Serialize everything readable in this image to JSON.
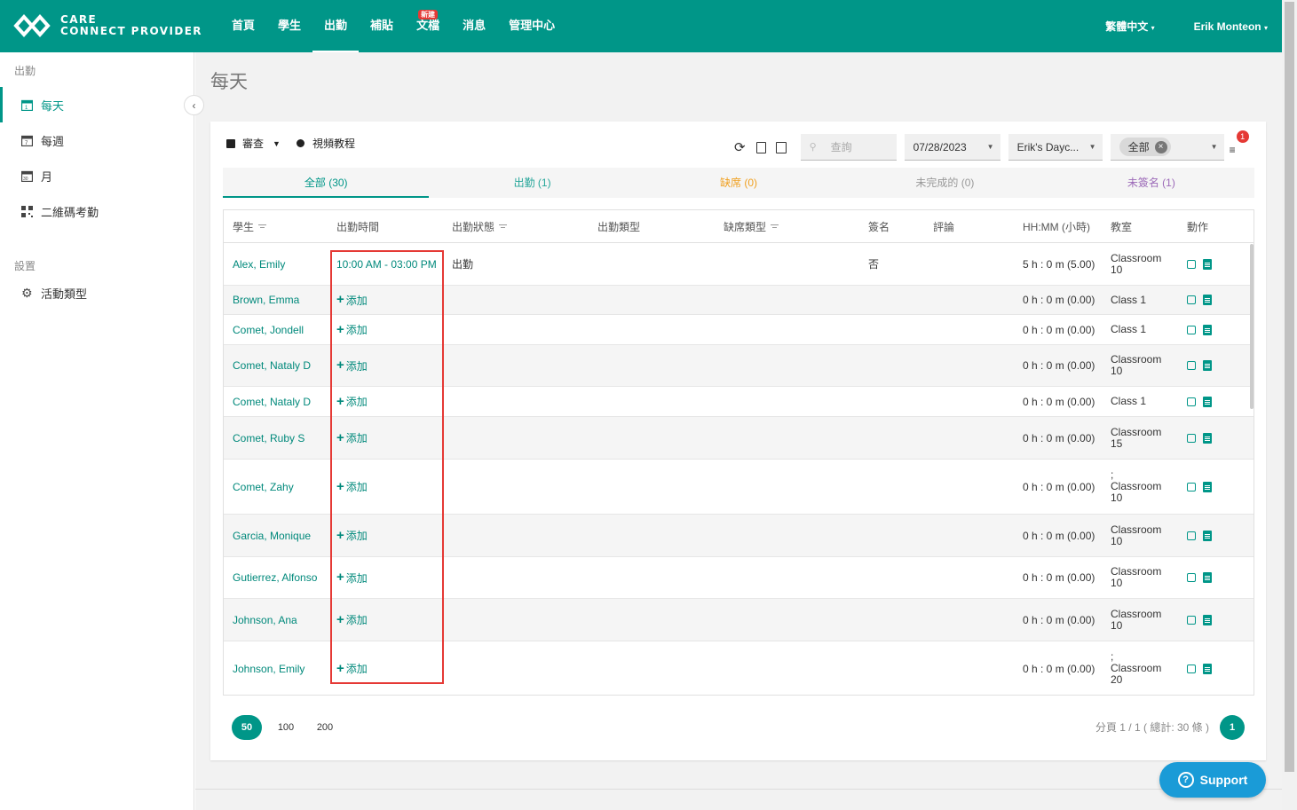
{
  "brand": {
    "line1": "CARE",
    "line2": "CONNECT PROVIDER"
  },
  "nav": [
    {
      "label": "首頁"
    },
    {
      "label": "學生"
    },
    {
      "label": "出勤",
      "active": true
    },
    {
      "label": "補貼"
    },
    {
      "label": "文檔",
      "badge": "新建"
    },
    {
      "label": "消息"
    },
    {
      "label": "管理中心"
    }
  ],
  "top_right": {
    "language": "繁體中文",
    "user": "Erik Monteon"
  },
  "sidebar": {
    "section1": "出勤",
    "items1": [
      {
        "label": "每天",
        "active": true
      },
      {
        "label": "每週"
      },
      {
        "label": "月"
      },
      {
        "label": "二維碼考勤"
      }
    ],
    "section2": "設置",
    "items2": [
      {
        "label": "活動類型"
      }
    ]
  },
  "page": {
    "title": "每天"
  },
  "toolbar": {
    "review": "審查",
    "video": "視頻教程",
    "search_placeholder": "查詢",
    "date": "07/28/2023",
    "center": "Erik's Dayc...",
    "filter_chip": "全部",
    "filter_count": "1"
  },
  "tabs": [
    {
      "label": "全部 (30)",
      "color": "#009688"
    },
    {
      "label": "出勤 (1)",
      "color": "#26a69a"
    },
    {
      "label": "缺席 (0)",
      "color": "#f0a020"
    },
    {
      "label": "未完成的 (0)",
      "color": "#999999"
    },
    {
      "label": "未簽名 (1)",
      "color": "#9c6ab8"
    }
  ],
  "columns": [
    "學生",
    "出勤時間",
    "出勤狀態",
    "出勤類型",
    "缺席類型",
    "簽名",
    "評論",
    "HH:MM (小時)",
    "教室",
    "動作"
  ],
  "rows": [
    {
      "student": "Alex, Emily",
      "time": "10:00 AM - 03:00 PM",
      "status": "出勤",
      "signature": "否",
      "hours": "5 h : 0 m (5.00)",
      "room": "Classroom 10"
    },
    {
      "student": "Brown, Emma",
      "time": "添加",
      "hours": "0 h : 0 m (0.00)",
      "room": "Class 1"
    },
    {
      "student": "Comet, Jondell",
      "time": "添加",
      "hours": "0 h : 0 m (0.00)",
      "room": "Class 1"
    },
    {
      "student": "Comet, Nataly D",
      "time": "添加",
      "hours": "0 h : 0 m (0.00)",
      "room": "Classroom 10"
    },
    {
      "student": "Comet, Nataly D",
      "time": "添加",
      "hours": "0 h : 0 m (0.00)",
      "room": "Class 1"
    },
    {
      "student": "Comet, Ruby S",
      "time": "添加",
      "hours": "0 h : 0 m (0.00)",
      "room": "Classroom 15"
    },
    {
      "student": "Comet, Zahy",
      "time": "添加",
      "hours": "0 h : 0 m (0.00)",
      "room": "; Classroom 10"
    },
    {
      "student": "Garcia, Monique",
      "time": "添加",
      "hours": "0 h : 0 m (0.00)",
      "room": "Classroom 10"
    },
    {
      "student": "Gutierrez, Alfonso",
      "time": "添加",
      "hours": "0 h : 0 m (0.00)",
      "room": "Classroom 10"
    },
    {
      "student": "Johnson, Ana",
      "time": "添加",
      "hours": "0 h : 0 m (0.00)",
      "room": "Classroom 10"
    },
    {
      "student": "Johnson, Emily",
      "time": "添加",
      "hours": "0 h : 0 m (0.00)",
      "room": "; Classroom 20"
    }
  ],
  "pagination": {
    "sizes": [
      "50",
      "100",
      "200"
    ],
    "info": "分頁 1 / 1 ( 總計: 30 條 )",
    "current": "1"
  },
  "support": "Support",
  "colors": {
    "primary": "#009688",
    "highlight": "#e53935",
    "support": "#1a9bd7"
  }
}
